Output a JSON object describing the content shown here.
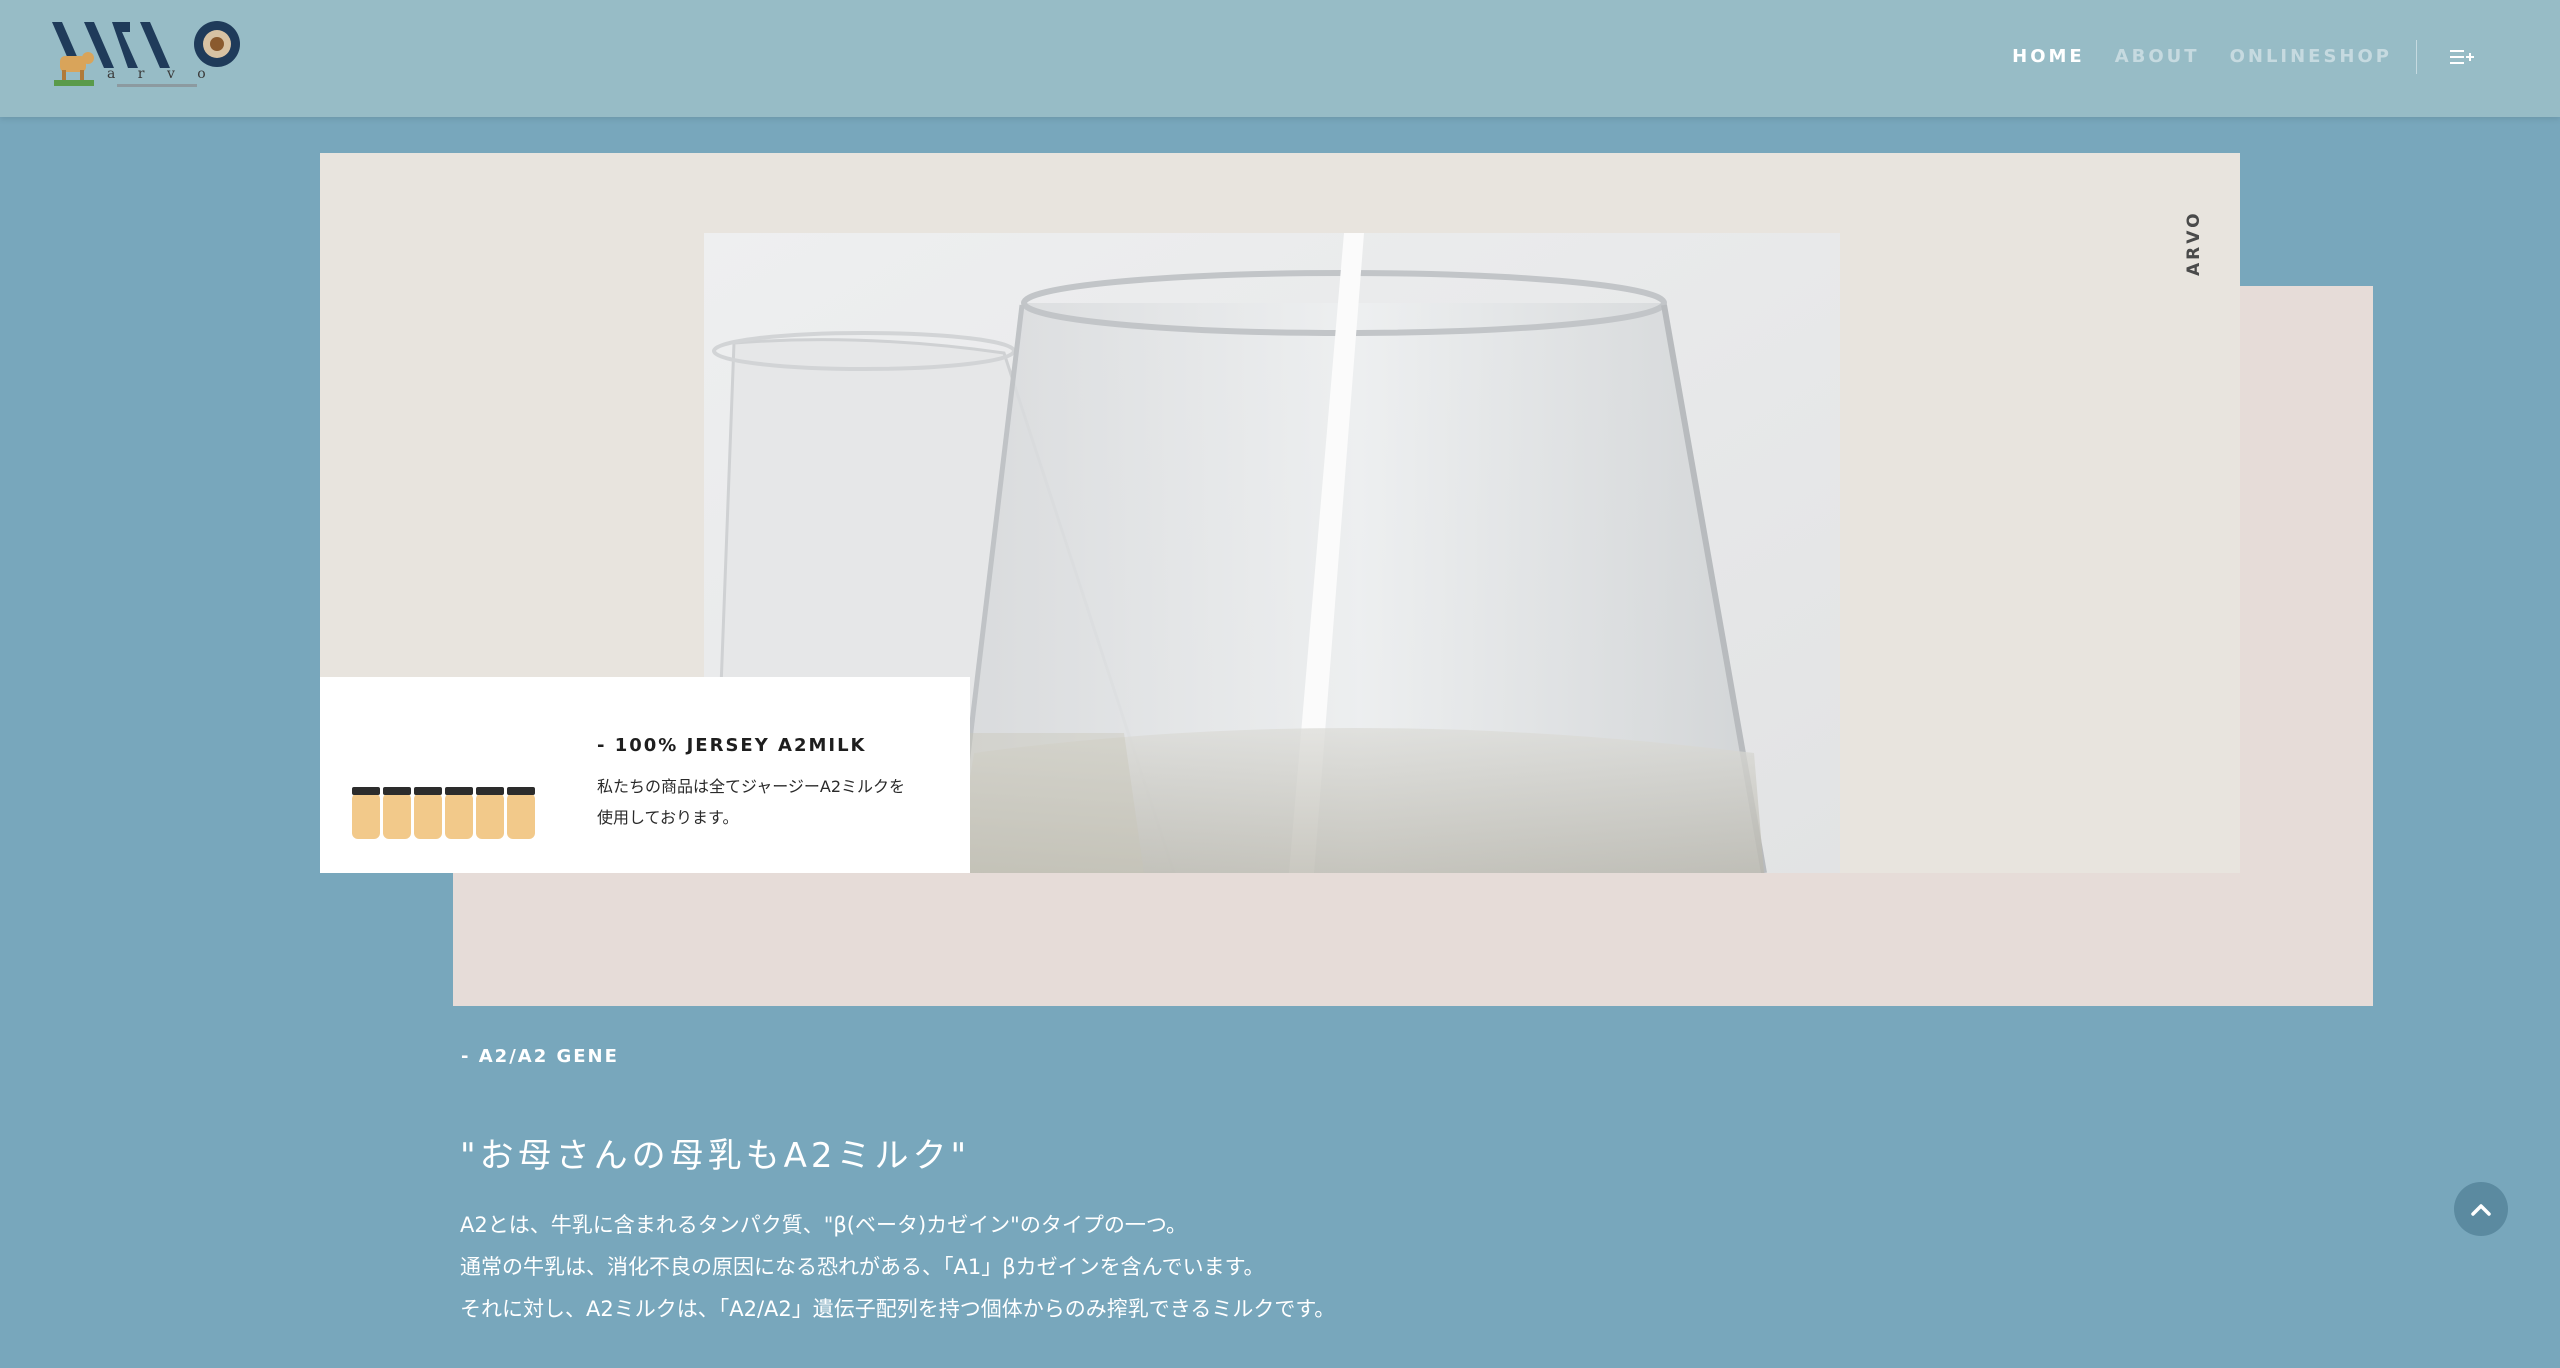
{
  "header": {
    "logo_text": "ARVO",
    "logo_subtext": "arvo",
    "nav": [
      "HOME",
      "ABOUT",
      "ONLINESHOP"
    ],
    "active_nav": "HOME",
    "menu_icon": "menu-plus-icon"
  },
  "hero": {
    "vertical_label": "ARVO",
    "card": {
      "title": "- 100% JERSEY A2MILK",
      "text_lines": [
        "私たちの商品は全てジャージーA2ミルクを",
        "使用しております。"
      ]
    }
  },
  "section": {
    "label": "- A2/A2 GENE",
    "heading": "\"お母さんの母乳もA2ミルク\"",
    "paragraphs": [
      "A2とは、牛乳に含まれるタンパク質、\"β(ベータ)カゼイン\"のタイプの一つ。",
      "通常の牛乳は、消化不良の原因になる恐れがある、「A1」βカゼインを含んでいます。",
      "それに対し、A2ミルクは、「A2/A2」遺伝子配列を持つ個体からのみ搾乳できるミルクです。"
    ]
  },
  "colors": {
    "background": "#78a7bc",
    "header": "#97bcc6",
    "front_panel": "#e8e4de",
    "back_panel": "#e6dcd8"
  }
}
